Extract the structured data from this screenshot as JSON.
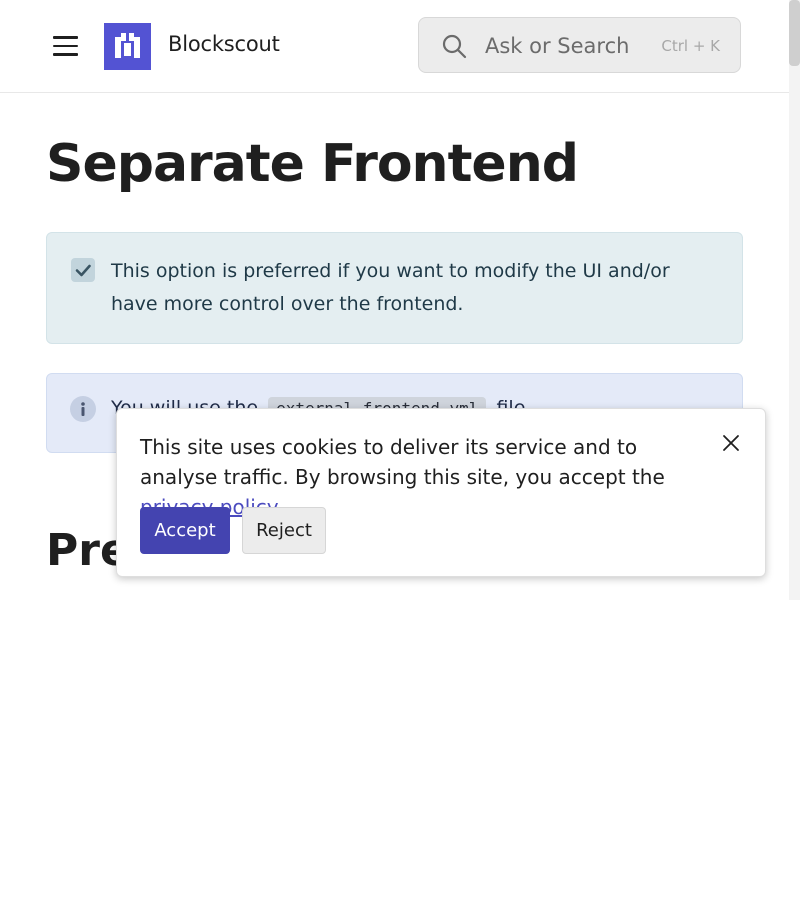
{
  "header": {
    "site_title": "Blockscout",
    "search": {
      "placeholder": "Ask or Search",
      "shortcut": "Ctrl + K"
    }
  },
  "main": {
    "page_title": "Separate Frontend",
    "note_callout": {
      "text": "This option is preferred if you want to modify the UI and/or have more control over the frontend."
    },
    "info_callout": {
      "text_before": "You will use the",
      "code": "external-frontend.yml",
      "text_after": "file."
    },
    "section_heading": "Prerequisites"
  },
  "cookie_banner": {
    "text_before_link": "This site uses cookies to deliver its service and to analyse traffic. By browsing this site, you accept the",
    "link_text": "privacy policy",
    "text_after_link": ".",
    "accept_label": "Accept",
    "reject_label": "Reject"
  },
  "colors": {
    "brand": "#5353d3",
    "accept_button": "#4444b0",
    "link": "#4b4bbf"
  }
}
